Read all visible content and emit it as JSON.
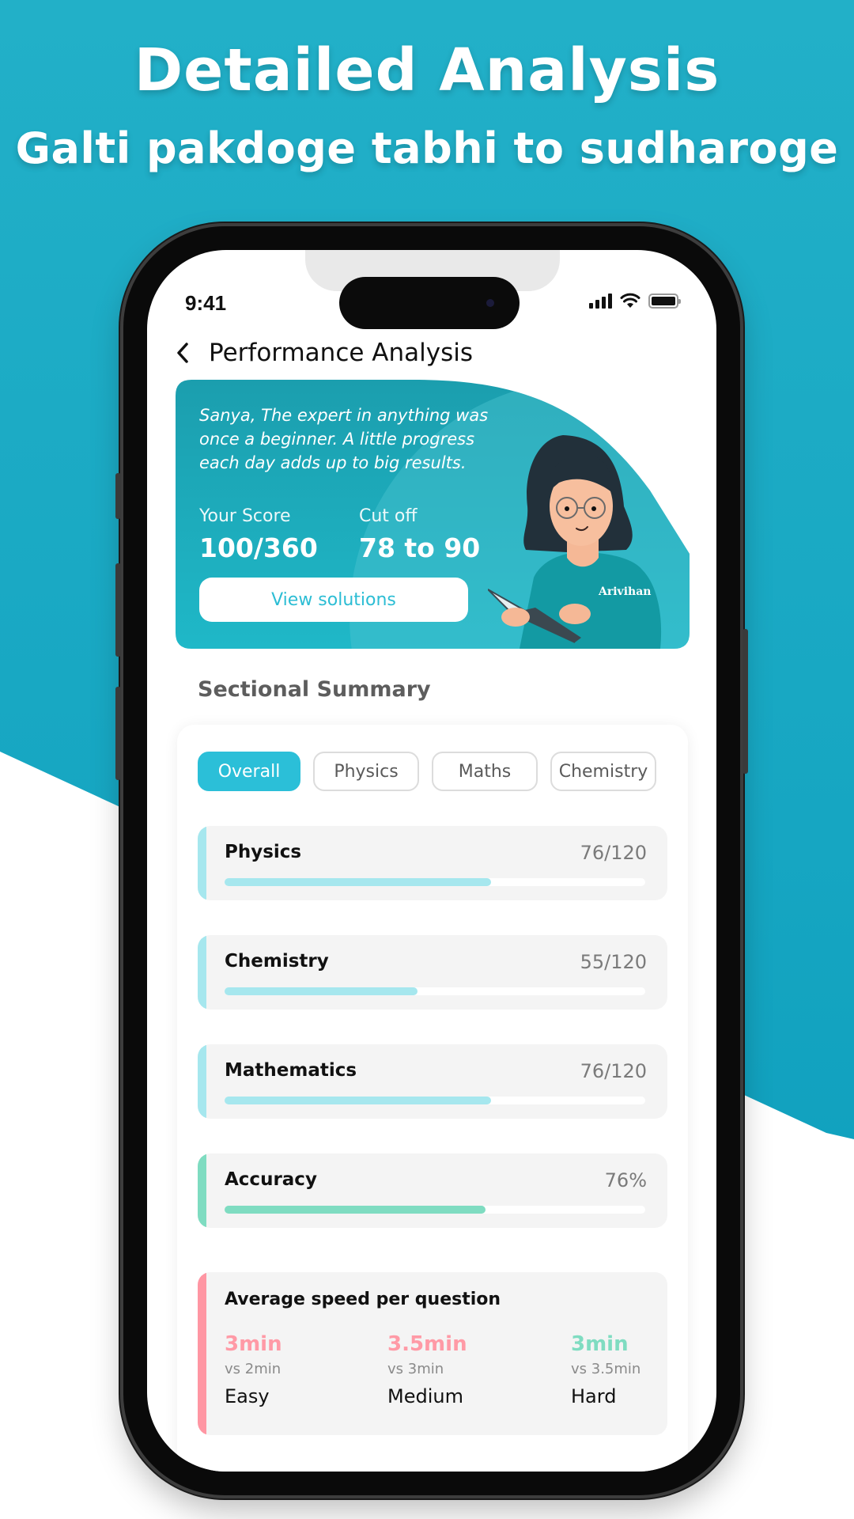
{
  "promo": {
    "headline": "Detailed Analysis",
    "subheadline": "Galti pakdoge tabhi to sudharoge",
    "background_color": "#1eaec8"
  },
  "status_bar": {
    "time": "9:41",
    "icons": [
      "cellular-signal-icon",
      "wifi-icon",
      "battery-icon"
    ]
  },
  "header": {
    "back_icon": "chevron-left-icon",
    "title": "Performance Analysis"
  },
  "banner": {
    "quote": "Sanya, The expert in anything was once a beginner. A little progress each day adds up to big results.",
    "score_label": "Your Score",
    "score_value": "100/360",
    "cutoff_label": "Cut off",
    "cutoff_value": "78 to 90",
    "button_label": "View solutions",
    "illustration_brand": "Arivihan",
    "colors": {
      "card": "#14a5b3",
      "button_text": "#2cbdd4"
    }
  },
  "sectional_summary": {
    "title": "Sectional Summary",
    "tabs": [
      {
        "label": "Overall",
        "active": true
      },
      {
        "label": "Physics",
        "active": false
      },
      {
        "label": "Maths",
        "active": false
      },
      {
        "label": "Chemistry",
        "active": false
      }
    ],
    "metrics": [
      {
        "name": "Physics",
        "value": "76/120",
        "progress": 0.633,
        "color": "#a6e7ee"
      },
      {
        "name": "Chemistry",
        "value": "55/120",
        "progress": 0.458,
        "color": "#a6e7ee"
      },
      {
        "name": "Mathematics",
        "value": "76/120",
        "progress": 0.633,
        "color": "#a6e7ee"
      },
      {
        "name": "Accuracy",
        "value": "76%",
        "progress": 0.62,
        "color": "#7fdcc1"
      }
    ],
    "speed": {
      "title": "Average speed per question",
      "accent_color": "#ff96a3",
      "items": [
        {
          "time": "3min",
          "vs": "vs 2min",
          "level": "Easy",
          "color": "#ff9aa6"
        },
        {
          "time": "3.5min",
          "vs": "vs 3min",
          "level": "Medium",
          "color": "#ff9aa6"
        },
        {
          "time": "3min",
          "vs": "vs 3.5min",
          "level": "Hard",
          "color": "#7fdcc1"
        }
      ]
    }
  }
}
